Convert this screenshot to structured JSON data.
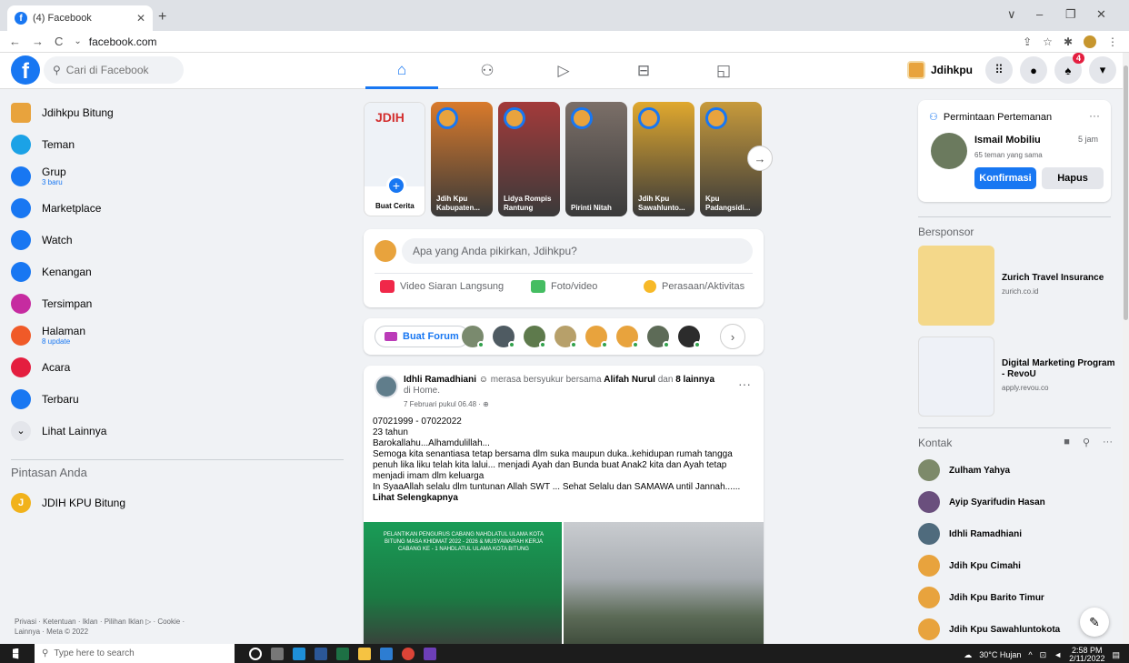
{
  "browser": {
    "tab_title": "(4) Facebook",
    "tab_icon": "f",
    "new_tab": "+",
    "url": "facebook.com",
    "window_controls": [
      "∨",
      "–",
      "❐",
      "✕"
    ]
  },
  "fb": {
    "logo": "f",
    "search_placeholder": "Cari di Facebook",
    "profile_name": "Jdihkpu",
    "notif_count": "4"
  },
  "left_nav": {
    "items": [
      {
        "label": "Jdihkpu Bitung",
        "icon": "page-avatar-icon",
        "color": "#e8a33d",
        "sub": ""
      },
      {
        "label": "Teman",
        "icon": "friends-icon",
        "color": "#1ba2e6",
        "sub": ""
      },
      {
        "label": "Grup",
        "icon": "groups-icon",
        "color": "#1877f2",
        "sub": "3 baru"
      },
      {
        "label": "Marketplace",
        "icon": "marketplace-icon",
        "color": "#1877f2",
        "sub": ""
      },
      {
        "label": "Watch",
        "icon": "watch-icon",
        "color": "#1877f2",
        "sub": ""
      },
      {
        "label": "Kenangan",
        "icon": "memories-icon",
        "color": "#1877f2",
        "sub": ""
      },
      {
        "label": "Tersimpan",
        "icon": "saved-icon",
        "color": "#c62ba0",
        "sub": ""
      },
      {
        "label": "Halaman",
        "icon": "pages-icon",
        "color": "#f05a28",
        "sub": "8 update"
      },
      {
        "label": "Acara",
        "icon": "events-icon",
        "color": "#e41e3f",
        "sub": ""
      },
      {
        "label": "Terbaru",
        "icon": "recent-icon",
        "color": "#1877f2",
        "sub": ""
      },
      {
        "label": "Lihat Lainnya",
        "icon": "chevron-down-icon",
        "color": "#e4e6eb",
        "sub": ""
      }
    ],
    "shortcuts_title": "Pintasan Anda",
    "shortcuts": [
      {
        "label": "JDIH KPU Bitung",
        "initial": "J"
      }
    ],
    "footer": "Privasi · Ketentuan · Iklan · Pilihan Iklan ▷ · Cookie · Lainnya · Meta © 2022"
  },
  "stories": {
    "create_label": "Buat Cerita",
    "create_logo": "JDIH",
    "items": [
      {
        "name": "Jdih Kpu Kabupaten...",
        "color": "#d97a2b"
      },
      {
        "name": "Lidya Rompis Rantung",
        "color": "#a33a3a"
      },
      {
        "name": "Pirinti Nitah",
        "color": "#7b6f68"
      },
      {
        "name": "Jdih Kpu Sawahlunto...",
        "color": "#e0a82e"
      },
      {
        "name": "Kpu Padangsidi...",
        "color": "#c79a3b"
      }
    ]
  },
  "composer": {
    "placeholder": "Apa yang Anda pikirkan, Jdihkpu?",
    "live_label": "Video Siaran Langsung",
    "photo_label": "Foto/video",
    "feeling_label": "Perasaan/Aktivitas"
  },
  "forum": {
    "create_label": "Buat Forum",
    "avatars": [
      "#7a8a6e",
      "#4f5b62",
      "#5e7a4c",
      "#b7a06a",
      "#e8a33d",
      "#e8a33d",
      "#5d6b57",
      "#2c2c2c"
    ]
  },
  "post": {
    "author": "Idhli Ramadhiani",
    "feeling_text": "merasa bersyukur bersama",
    "tagged": "Alifah Nurul",
    "connector": "dan",
    "others": "8 lainnya",
    "at": "di Home.",
    "time": "7 Februari pukul 06.48 · ⊕",
    "lines": [
      "07021999 - 07022022",
      "23 tahun",
      "Barokallahu...Alhamdulillah...",
      "Semoga kita senantiasa tetap bersama dlm suka maupun duka..kehidupan rumah tangga penuh lika liku telah kita lalui... menjadi Ayah dan Bunda buat Anak2 kita dan Ayah tetap menjadi imam dlm keluarga",
      "In SyaaAllah selalu dlm tuntunan Allah SWT ... Sehat Selalu dan SAMAWA until Jannah......"
    ],
    "see_more": "Lihat Selengkapnya",
    "image_banner": "PELANTIKAN PENGURUS CABANG NAHDLATUL ULAMA KOTA BITUNG MASA KHIDMAT 2022 - 2026 & MUSYAWARAH KERJA CABANG KE - 1 NAHDLATUL ULAMA KOTA BITUNG"
  },
  "right": {
    "friend_request_title": "Permintaan Pertemanan",
    "fr_name": "Ismail Mobiliu",
    "fr_time": "5 jam",
    "fr_mutual": "65 teman yang sama",
    "confirm": "Konfirmasi",
    "delete": "Hapus",
    "sponsored_title": "Bersponsor",
    "ads": [
      {
        "title": "Zurich Travel Insurance",
        "url": "zurich.co.id",
        "color": "#f4d88a"
      },
      {
        "title": "Digital Marketing Program - RevoU",
        "url": "apply.revou.co",
        "color": "#eef1f7"
      }
    ],
    "contacts_title": "Kontak",
    "contacts": [
      {
        "name": "Zulham Yahya",
        "color": "#7d8a6a"
      },
      {
        "name": "Ayip Syarifudin Hasan",
        "color": "#6a4f7d"
      },
      {
        "name": "Idhli Ramadhiani",
        "color": "#4f6b7d"
      },
      {
        "name": "Jdih Kpu Cimahi",
        "color": "#e8a33d"
      },
      {
        "name": "Jdih Kpu Barito Timur",
        "color": "#e8a33d"
      },
      {
        "name": "Jdih Kpu Sawahluntokota",
        "color": "#e8a33d"
      }
    ]
  },
  "taskbar": {
    "search_placeholder": "Type here to search",
    "weather": "30°C Hujan",
    "time": "2:58 PM",
    "date": "2/11/2022"
  }
}
